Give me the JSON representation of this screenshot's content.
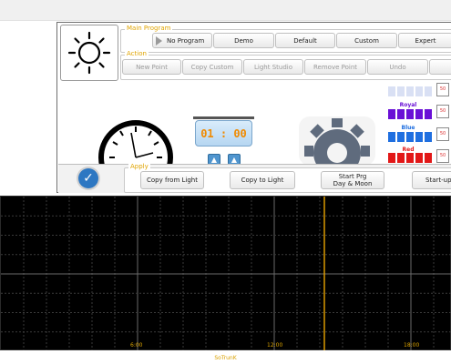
{
  "main_program": {
    "title": "Main Program",
    "buttons": [
      "No Program",
      "Demo",
      "Default",
      "Custom",
      "Expert"
    ]
  },
  "action": {
    "title": "Action",
    "buttons": [
      "New Point",
      "Copy Custom",
      "Light Studio",
      "Remove Point",
      "Undo"
    ]
  },
  "channels": [
    {
      "label": "",
      "color": "#d3dbf2",
      "values": [
        "50",
        "50"
      ]
    },
    {
      "label": "Royal",
      "color": "#6a10d6",
      "values": [
        "50",
        "50"
      ]
    },
    {
      "label": "Blue",
      "color": "#1f6fe0",
      "values": [
        "50",
        "50"
      ]
    },
    {
      "label": "Red",
      "color": "#e21818",
      "values": [
        "50",
        "50"
      ]
    }
  ],
  "timer": {
    "value": "01 : 00"
  },
  "apply": {
    "title": "Apply",
    "buttons": [
      "Copy from Light",
      "Copy to Light",
      "Start Prg\nDay & Moon",
      "Start-up se"
    ]
  },
  "chart_data": {
    "type": "line",
    "x_ticks": [
      "6:00",
      "12:00",
      "18:00"
    ],
    "x_range": [
      "0:00",
      "24:00"
    ],
    "grid": true,
    "marker": "14:00",
    "series": [],
    "footer_label": "SoTrunK"
  },
  "colors": {
    "accent": "#e0a400",
    "chart_bg": "#000000",
    "marker": "#e8a200"
  }
}
